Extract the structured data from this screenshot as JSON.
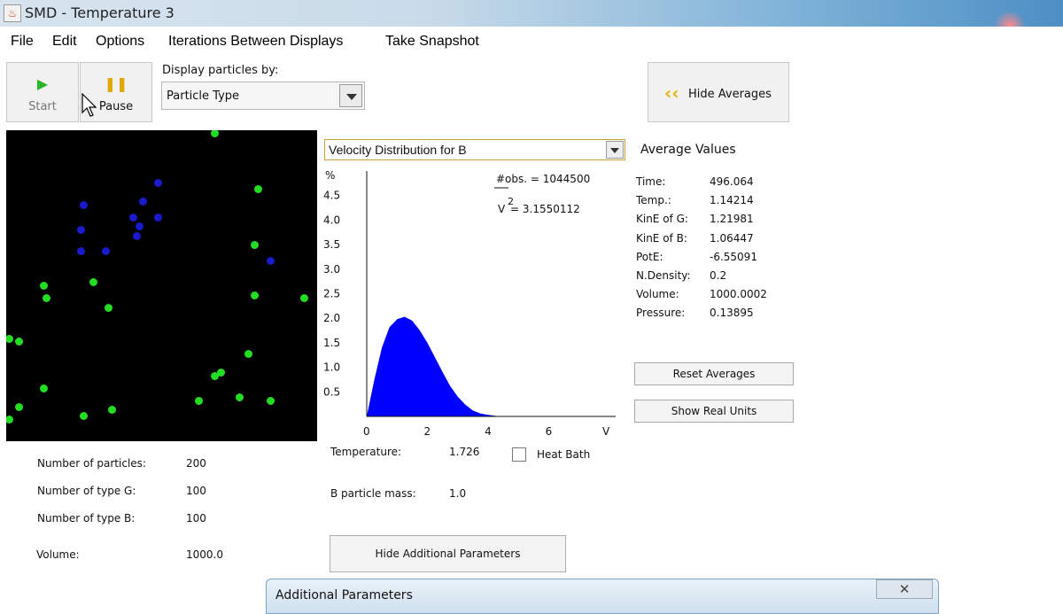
{
  "window": {
    "title": "SMD - Temperature 3"
  },
  "menu": [
    "File",
    "Edit",
    "Options",
    "Iterations Between Displays",
    "Take Snapshot"
  ],
  "toolbar": {
    "start_label": "Start",
    "pause_label": "Pause",
    "display_by_label": "Display particles by:",
    "display_by_value": "Particle Type",
    "hide_averages_label": "Hide Averages"
  },
  "colors": {
    "type_g": "#22dd22",
    "type_b": "#1a1acc",
    "histogram": "#0000ff"
  },
  "particles": {
    "g": [
      [
        0.67,
        0.01
      ],
      [
        0.81,
        0.19
      ],
      [
        0.8,
        0.37
      ],
      [
        0.96,
        0.54
      ],
      [
        0.8,
        0.53
      ],
      [
        0.12,
        0.5
      ],
      [
        0.28,
        0.49
      ],
      [
        0.33,
        0.57
      ],
      [
        0.13,
        0.54
      ],
      [
        0.01,
        0.67
      ],
      [
        0.04,
        0.68
      ],
      [
        0.78,
        0.72
      ],
      [
        0.69,
        0.78
      ],
      [
        0.67,
        0.79
      ],
      [
        0.12,
        0.83
      ],
      [
        0.62,
        0.87
      ],
      [
        0.75,
        0.86
      ],
      [
        0.85,
        0.87
      ],
      [
        0.04,
        0.89
      ],
      [
        0.34,
        0.9
      ],
      [
        0.25,
        0.92
      ],
      [
        0.01,
        0.93
      ]
    ],
    "b": [
      [
        0.49,
        0.17
      ],
      [
        0.44,
        0.23
      ],
      [
        0.25,
        0.24
      ],
      [
        0.41,
        0.28
      ],
      [
        0.49,
        0.28
      ],
      [
        0.43,
        0.31
      ],
      [
        0.24,
        0.32
      ],
      [
        0.42,
        0.34
      ],
      [
        0.24,
        0.39
      ],
      [
        0.32,
        0.39
      ],
      [
        0.85,
        0.42
      ]
    ]
  },
  "histogram": {
    "selector": "Velocity Distribution for B",
    "y_unit": "%",
    "x_unit": "V",
    "obs_text": "#obs. = 1044500",
    "v2_text": "V",
    "v2_exp": "2",
    "v2_value": "= 3.1550112",
    "chart_data": {
      "type": "area",
      "title": "Velocity Distribution for B",
      "xlabel": "V",
      "ylabel": "%",
      "xlim": [
        0,
        8.2
      ],
      "ylim": [
        0,
        5.0
      ],
      "x_ticks": [
        0,
        2,
        4,
        6
      ],
      "y_ticks": [
        0.5,
        1.0,
        1.5,
        2.0,
        2.5,
        3.0,
        3.5,
        4.0,
        4.5
      ],
      "x_tick_labels": [
        "0",
        "2",
        "4",
        "6"
      ],
      "y_tick_labels": [
        "0.5",
        "1.0",
        "1.5",
        "2.0",
        "2.5",
        "3.0",
        "3.5",
        "4.0",
        "4.5"
      ],
      "series": [
        {
          "x": [
            0,
            0.25,
            0.5,
            0.75,
            1.0,
            1.25,
            1.5,
            1.75,
            2.0,
            2.25,
            2.5,
            2.75,
            3.0,
            3.25,
            3.5,
            3.75,
            4.0,
            4.25,
            4.5
          ],
          "values": [
            0,
            0.75,
            1.4,
            1.82,
            1.98,
            2.03,
            1.95,
            1.75,
            1.5,
            1.2,
            0.9,
            0.62,
            0.4,
            0.24,
            0.12,
            0.06,
            0.03,
            0.01,
            0
          ]
        }
      ]
    }
  },
  "averages": {
    "title": "Average Values",
    "rows": [
      {
        "label": "Time:",
        "value": "496.064"
      },
      {
        "label": "Temp.:",
        "value": "1.14214"
      },
      {
        "label": "KinE of G:",
        "value": "1.21981"
      },
      {
        "label": "KinE of B:",
        "value": "1.06447"
      },
      {
        "label": "PotE:",
        "value": "-6.55091"
      },
      {
        "label": "N.Density:",
        "value": "0.2"
      },
      {
        "label": "Volume:",
        "value": "1000.0002"
      },
      {
        "label": "Pressure:",
        "value": "0.13895"
      }
    ],
    "reset_label": "Reset Averages",
    "real_units_label": "Show Real Units"
  },
  "params": {
    "num_particles_label": "Number of particles:",
    "num_particles_value": "200",
    "num_g_label": "Number of type G:",
    "num_g_value": "100",
    "num_b_label": "Number of type B:",
    "num_b_value": "100",
    "volume_label": "Volume:",
    "volume_value": "1000.0",
    "temperature_label": "Temperature:",
    "temperature_value": "1.726",
    "heat_bath_label": "Heat Bath",
    "b_mass_label": "B particle mass:",
    "b_mass_value": "1.0",
    "hide_params_label": "Hide Additional Parameters"
  },
  "dialog": {
    "title": "Additional Parameters",
    "close_glyph": "✕"
  }
}
